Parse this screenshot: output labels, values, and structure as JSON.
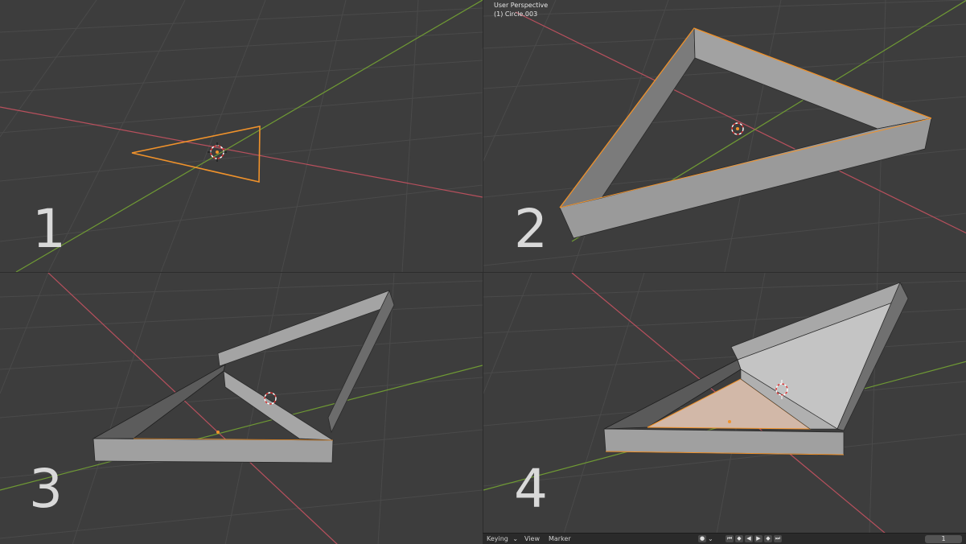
{
  "app": "Blender",
  "panels": [
    {
      "number": "1"
    },
    {
      "number": "2"
    },
    {
      "number": "3"
    },
    {
      "number": "4"
    }
  ],
  "viewport_overlay": {
    "view_name": "User Perspective",
    "object_name": "(1) Circle.003"
  },
  "timeline": {
    "keying_label": "Keying",
    "keying_chevron": "⌄",
    "view_label": "View",
    "marker_label": "Marker",
    "record_glyph": "●",
    "record_chevron": "⌄",
    "jump_start_glyph": "⏮",
    "prev_key_glyph": "◆",
    "play_reverse_glyph": "◀",
    "play_glyph": "▶",
    "next_key_glyph": "◆",
    "jump_end_glyph": "⏭",
    "current_frame": "1"
  },
  "colors": {
    "viewport_bg": "#3d3d3d",
    "grid": "#4a4a4a",
    "x_axis": "#b8505d",
    "y_axis": "#6f9a34",
    "selection": "#f0922b",
    "mesh_face": "#9c9c9c",
    "mesh_face_dark": "#7d7d7d",
    "panel_number": "#d9d9d9"
  },
  "icons": [
    "3d-cursor-icon",
    "origin-dot-icon",
    "record-icon",
    "jump-start-icon",
    "play-icon",
    "jump-end-icon"
  ]
}
